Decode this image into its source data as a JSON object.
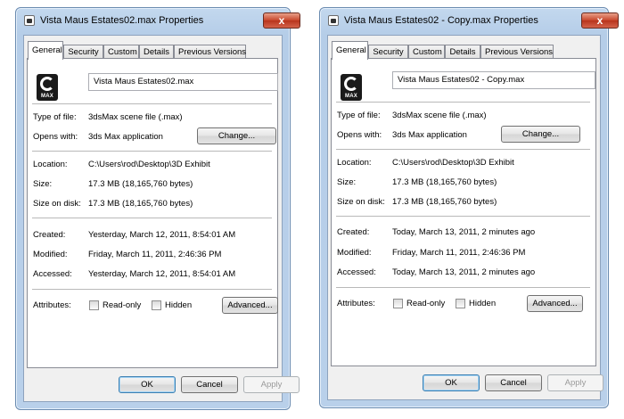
{
  "windows": [
    {
      "title": "Vista Maus Estates02.max Properties",
      "close_label": "x",
      "tabs": [
        "General",
        "Security",
        "Custom",
        "Details",
        "Previous Versions"
      ],
      "file_icon_label": "MAX",
      "filename": "Vista Maus Estates02.max",
      "type_label": "Type of file:",
      "type_value": "3dsMax scene file (.max)",
      "opens_label": "Opens with:",
      "opens_value": "3ds Max application",
      "change_label": "Change...",
      "location_label": "Location:",
      "location_value": "C:\\Users\\rod\\Desktop\\3D Exhibit",
      "size_label": "Size:",
      "size_value": "17.3 MB (18,165,760 bytes)",
      "disk_label": "Size on disk:",
      "disk_value": "17.3 MB (18,165,760 bytes)",
      "created_label": "Created:",
      "created_value": "Yesterday, March 12, 2011, 8:54:01 AM",
      "modified_label": "Modified:",
      "modified_value": "Friday, March 11, 2011, 2:46:36 PM",
      "accessed_label": "Accessed:",
      "accessed_value": "Yesterday, March 12, 2011, 8:54:01 AM",
      "attributes_label": "Attributes:",
      "readonly_label": "Read-only",
      "hidden_label": "Hidden",
      "advanced_label": "Advanced...",
      "ok_label": "OK",
      "cancel_label": "Cancel",
      "apply_label": "Apply"
    },
    {
      "title": "Vista Maus Estates02 - Copy.max Properties",
      "close_label": "x",
      "tabs": [
        "General",
        "Security",
        "Custom",
        "Details",
        "Previous Versions"
      ],
      "file_icon_label": "MAX",
      "filename": "Vista Maus Estates02 - Copy.max",
      "type_label": "Type of file:",
      "type_value": "3dsMax scene file (.max)",
      "opens_label": "Opens with:",
      "opens_value": "3ds Max application",
      "change_label": "Change...",
      "location_label": "Location:",
      "location_value": "C:\\Users\\rod\\Desktop\\3D Exhibit",
      "size_label": "Size:",
      "size_value": "17.3 MB (18,165,760 bytes)",
      "disk_label": "Size on disk:",
      "disk_value": "17.3 MB (18,165,760 bytes)",
      "created_label": "Created:",
      "created_value": "Today, March 13, 2011, 2 minutes ago",
      "modified_label": "Modified:",
      "modified_value": "Friday, March 11, 2011, 2:46:36 PM",
      "accessed_label": "Accessed:",
      "accessed_value": "Today, March 13, 2011, 2 minutes ago",
      "attributes_label": "Attributes:",
      "readonly_label": "Read-only",
      "hidden_label": "Hidden",
      "advanced_label": "Advanced...",
      "ok_label": "OK",
      "cancel_label": "Cancel",
      "apply_label": "Apply"
    }
  ]
}
